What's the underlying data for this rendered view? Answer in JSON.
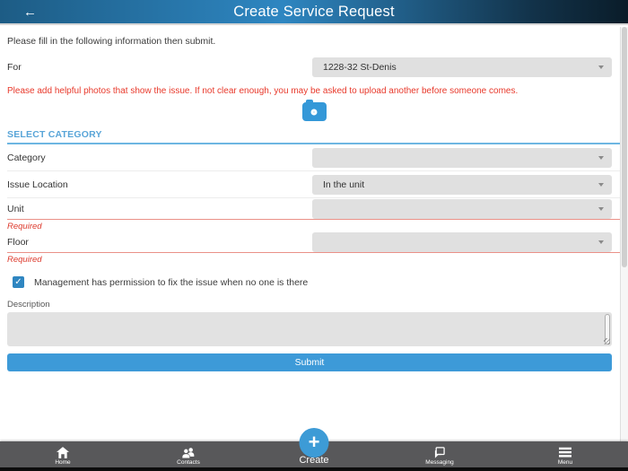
{
  "header": {
    "title": "Create Service Request",
    "back_icon": "←"
  },
  "intro_text": "Please fill in the following information then submit.",
  "form": {
    "for_label": "For",
    "for_value": "1228-32 St-Denis",
    "photo_hint": "Please add helpful photos that show the issue. If not clear enough, you may be asked to upload another before someone comes.",
    "section_title": "SELECT CATEGORY",
    "fields": [
      {
        "label": "Category",
        "value": ""
      },
      {
        "label": "Issue Location",
        "value": "In the unit"
      },
      {
        "label": "Unit",
        "value": "",
        "required_label": "Required"
      },
      {
        "label": "Floor",
        "value": "",
        "required_label": "Required"
      }
    ],
    "checkbox": {
      "checked": true,
      "check_glyph": "✓",
      "label": "Management has permission to fix the issue when no one is there"
    },
    "description_label": "Description",
    "description_value": "",
    "submit_label": "Submit"
  },
  "bottom_nav": {
    "create_plus_glyph": "+",
    "items": [
      {
        "label": "Home"
      },
      {
        "label": "Contacts"
      },
      {
        "label": "Create"
      },
      {
        "label": "Messaging"
      },
      {
        "label": "Menu"
      }
    ]
  },
  "colors": {
    "header_blue": "#2e86c1",
    "accent_blue": "#3d9ad8",
    "section_blue": "#59a5d8",
    "error_red": "#dd3a2d",
    "nav_gray": "#58585a",
    "field_gray": "#e0e0e0"
  }
}
